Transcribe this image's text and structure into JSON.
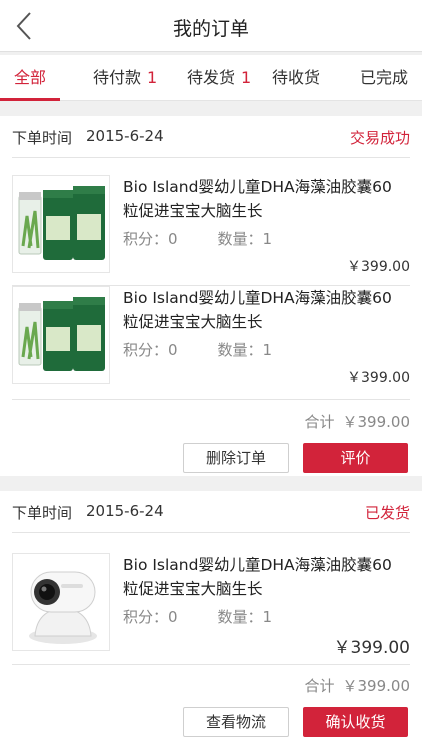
{
  "header": {
    "title": "我的订单",
    "back_icon": "chevron-left-icon"
  },
  "tabs": [
    {
      "label": "全部",
      "count": ""
    },
    {
      "label": "待付款",
      "count": "1"
    },
    {
      "label": "待发货",
      "count": "1"
    },
    {
      "label": "待收货",
      "count": ""
    },
    {
      "label": "已完成",
      "count": ""
    }
  ],
  "orders": [
    {
      "time_label": "下单时间",
      "time": "2015-6-24",
      "status": "交易成功",
      "items": [
        {
          "image": "tea-tins-image",
          "name": "Bio Island婴幼儿童DHA海藻油胶囊60粒促进宝宝大脑生长",
          "points": "积分：0",
          "qty": "数量：1",
          "price": "￥399.00"
        },
        {
          "image": "tea-tins-image",
          "name": "Bio Island婴幼儿童DHA海藻油胶囊60粒促进宝宝大脑生长",
          "points": "积分：0",
          "qty": "数量：1",
          "price": "￥399.00"
        }
      ],
      "total_label": "合计",
      "total": "￥399.00",
      "btn_secondary": "删除订单",
      "btn_primary": "评价"
    },
    {
      "time_label": "下单时间",
      "time": "2015-6-24",
      "status": "已发货",
      "items": [
        {
          "image": "security-camera-image",
          "name": "Bio Island婴幼儿童DHA海藻油胶囊60粒促进宝宝大脑生长",
          "points": "积分：0",
          "qty": "数量：1",
          "price": "￥399.00"
        }
      ],
      "total_label": "合计",
      "total": "￥399.00",
      "btn_secondary": "查看物流",
      "btn_primary": "确认收货"
    }
  ],
  "colors": {
    "accent": "#d2233a",
    "background": "#f0f0f0"
  }
}
